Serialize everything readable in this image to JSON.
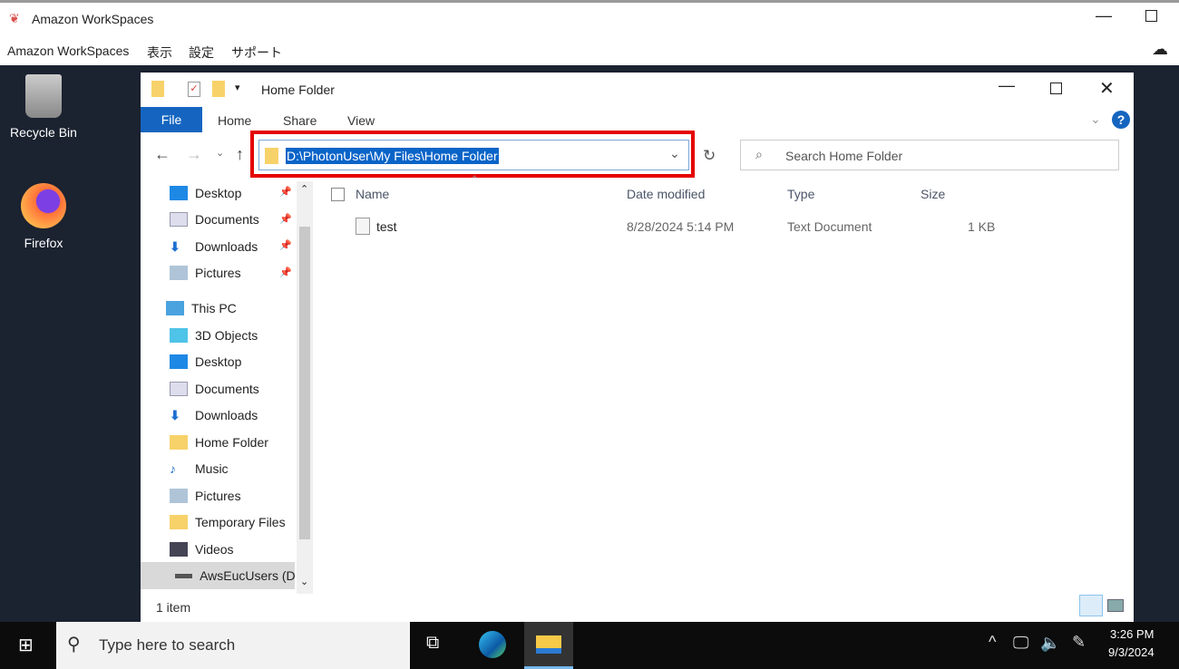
{
  "app": {
    "title": "Amazon WorkSpaces",
    "menu": [
      "Amazon WorkSpaces",
      "表示",
      "設定",
      "サポート"
    ]
  },
  "desktop": {
    "icons": [
      {
        "label": "Recycle Bin",
        "icon": "recycle-bin-icon"
      },
      {
        "label": "Firefox",
        "icon": "firefox-icon"
      }
    ]
  },
  "explorer": {
    "title": "Home Folder",
    "tabs": [
      "File",
      "Home",
      "Share",
      "View"
    ],
    "address": "D:\\PhotonUser\\My Files\\Home Folder",
    "search_placeholder": "Search Home Folder",
    "quick_access": [
      "Desktop",
      "Documents",
      "Downloads",
      "Pictures"
    ],
    "this_pc": "This PC",
    "pc_items": [
      "3D Objects",
      "Desktop",
      "Documents",
      "Downloads",
      "Home Folder",
      "Music",
      "Pictures",
      "Temporary Files",
      "Videos",
      "AwsEucUsers (D:"
    ],
    "columns": [
      "Name",
      "Date modified",
      "Type",
      "Size"
    ],
    "files": [
      {
        "name": "test",
        "date": "8/28/2024 5:14 PM",
        "type": "Text Document",
        "size": "1 KB"
      }
    ],
    "status": "1 item"
  },
  "taskbar": {
    "search_placeholder": "Type here to search",
    "time": "3:26 PM",
    "date": "9/3/2024"
  },
  "colors": {
    "accent": "#1565c0",
    "highlight": "#e50000",
    "desktop": "#1b2230"
  }
}
